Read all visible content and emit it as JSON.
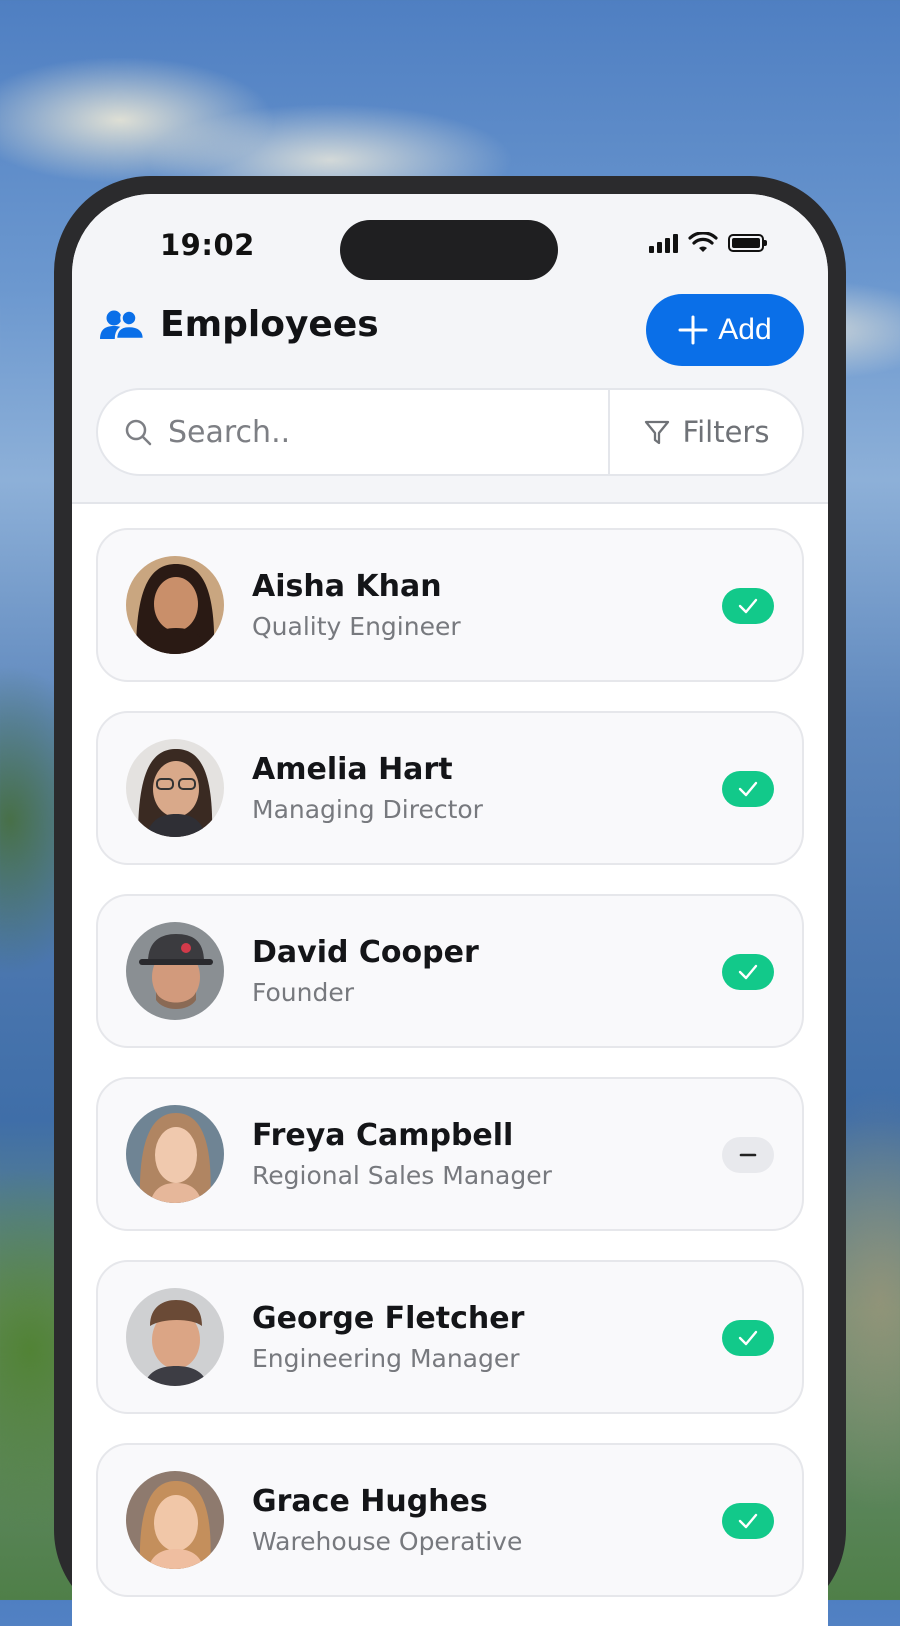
{
  "status_bar": {
    "time": "19:02"
  },
  "header": {
    "title": "Employees",
    "add_label": "Add"
  },
  "search": {
    "placeholder": "Search..",
    "filters_label": "Filters"
  },
  "colors": {
    "accent": "#0a6fe8",
    "active": "#12c98a",
    "inactive": "#e8e9ed"
  },
  "employees": [
    {
      "name": "Aisha Khan",
      "role": "Quality Engineer",
      "status": "active"
    },
    {
      "name": "Amelia Hart",
      "role": "Managing Director",
      "status": "active"
    },
    {
      "name": "David Cooper",
      "role": "Founder",
      "status": "active"
    },
    {
      "name": "Freya Campbell",
      "role": "Regional Sales Manager",
      "status": "inactive"
    },
    {
      "name": "George Fletcher",
      "role": "Engineering Manager",
      "status": "active"
    },
    {
      "name": "Grace Hughes",
      "role": "Warehouse Operative",
      "status": "active"
    }
  ]
}
